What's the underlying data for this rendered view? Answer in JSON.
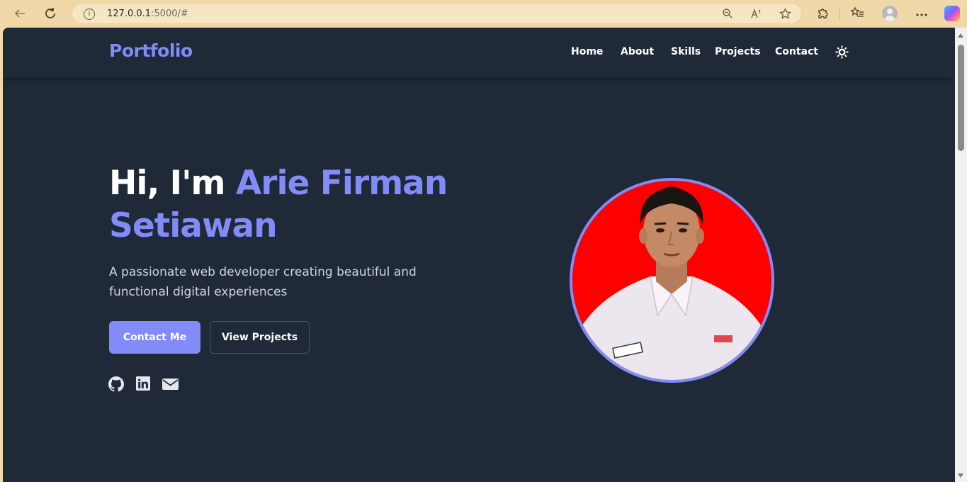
{
  "browser": {
    "url_host": "127.0.0.1",
    "url_rest": ":5000/#",
    "icons": [
      "back-icon",
      "refresh-icon",
      "info-icon",
      "zoom-icon",
      "read-aloud-icon",
      "favorite-icon",
      "extensions-icon",
      "favorites-list-icon",
      "profile-icon",
      "more-icon",
      "copilot-icon"
    ]
  },
  "header": {
    "logo": "Portfolio",
    "nav": [
      "Home",
      "About",
      "Skills",
      "Projects",
      "Contact"
    ]
  },
  "hero": {
    "greeting": "Hi, I'm ",
    "name_line1": "Arie Firman",
    "name_line2": "Setiawan",
    "subtitle": "A passionate web developer creating beautiful and functional digital experiences",
    "primary_button": "Contact Me",
    "secondary_button": "View Projects",
    "socials": [
      "github-icon",
      "linkedin-icon",
      "email-icon"
    ]
  },
  "colors": {
    "accent": "#818cf8",
    "background": "#1f2937",
    "photo_bg": "#ff0000"
  }
}
